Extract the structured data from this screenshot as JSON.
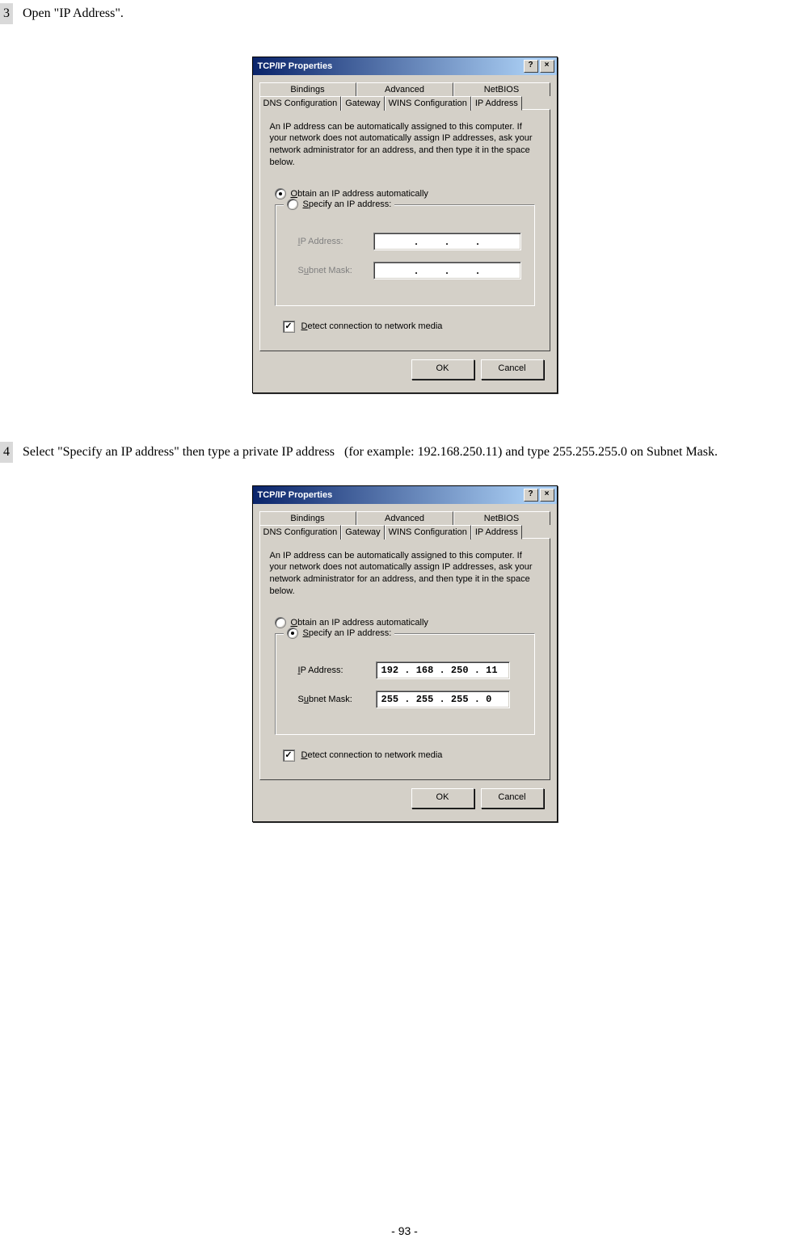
{
  "step3": {
    "num": "3",
    "text": "Open \"IP Address\"."
  },
  "step4": {
    "num": "4",
    "text_a": "Select \"Specify an IP address\" then type a private IP address",
    "text_b": "(for example: 192.168.250.11)",
    "text_c": "and type 255.255.255.0 on Subnet Mask."
  },
  "dialog": {
    "title": "TCP/IP Properties",
    "help_btn": "?",
    "close_btn": "×",
    "tabs": {
      "bindings": "Bindings",
      "advanced": "Advanced",
      "netbios": "NetBIOS",
      "dns": "DNS Configuration",
      "gateway": "Gateway",
      "wins": "WINS Configuration",
      "ip": "IP Address"
    },
    "panel_text": "An IP address can be automatically assigned to this computer. If your network does not automatically assign IP addresses, ask your network administrator for an address, and then type it in the space below.",
    "radio_obtain_u": "O",
    "radio_obtain_rest": "btain an IP address automatically",
    "radio_specify_u": "S",
    "radio_specify_rest": "pecify an IP address:",
    "ip_label_u": "I",
    "ip_label_rest": "P Address:",
    "subnet_label": "S",
    "subnet_label_u": "u",
    "subnet_label_rest": "bnet Mask:",
    "detect_u": "D",
    "detect_rest": "etect connection to network media",
    "ok": "OK",
    "cancel": "Cancel",
    "check_mark": "✓"
  },
  "dialog2": {
    "ip_value": "192 . 168 . 250 . 11",
    "subnet_value": "255 . 255 . 255 .  0"
  },
  "footer": "- 93 -"
}
